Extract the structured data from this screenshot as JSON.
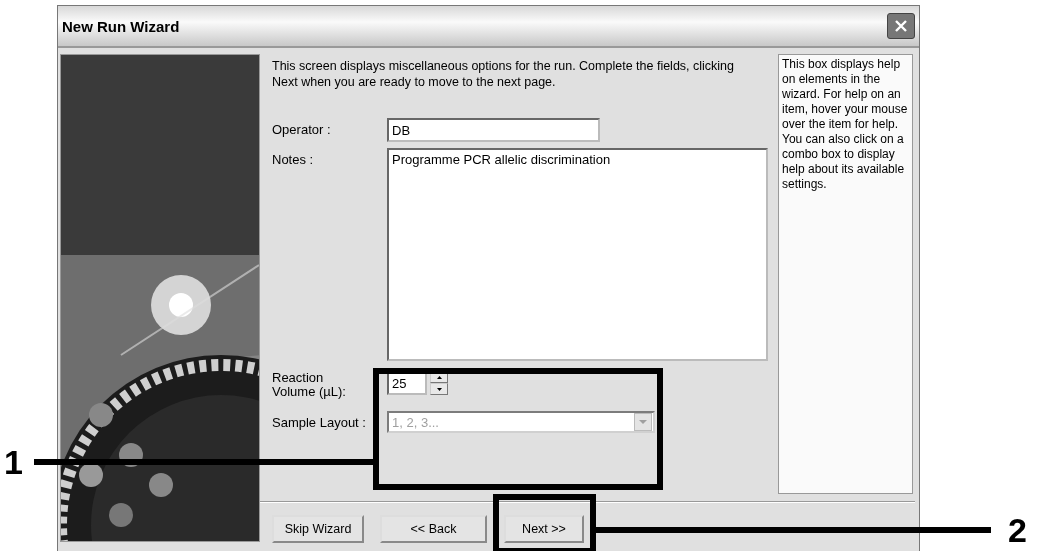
{
  "window": {
    "title": "New Run Wizard"
  },
  "intro": "This screen displays miscellaneous options for the run. Complete the fields, clicking Next when you are ready to move to the next page.",
  "fields": [
    {
      "kind": "text",
      "label": "Operator :",
      "value": "DB"
    },
    {
      "kind": "textarea",
      "label": "Notes :",
      "value": "Programme PCR allelic discrimination"
    },
    {
      "kind": "spinner",
      "label": "Reaction Volume (µL):",
      "value": "25"
    },
    {
      "kind": "combo",
      "label": "Sample Layout :",
      "value": "1, 2, 3...",
      "disabled": true
    }
  ],
  "help": "This box displays help on elements in the wizard. For help on an item, hover your mouse over the item for help. You can also click on a combo box to display help about its available settings.",
  "buttons": [
    "Skip Wizard",
    "<< Back",
    "Next >>"
  ],
  "callouts": [
    {
      "number": "1"
    },
    {
      "number": "2"
    }
  ]
}
